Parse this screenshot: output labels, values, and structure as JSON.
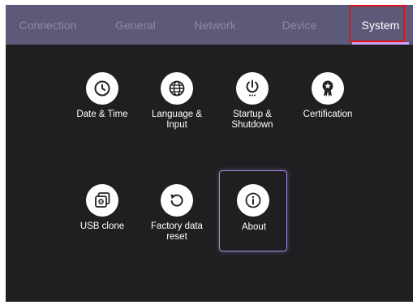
{
  "tabs": [
    {
      "label": "Connection"
    },
    {
      "label": "General"
    },
    {
      "label": "Network"
    },
    {
      "label": "Device"
    },
    {
      "label": "System"
    }
  ],
  "active_tab": "System",
  "colors": {
    "tab_bar": "#5c5a78",
    "tab_inactive_text": "#8b89a4",
    "tab_active_underline": "#c8a4ff",
    "screen_background": "#1f1f21",
    "highlight_box": "#e0141e",
    "selected_tile_border": "#a98be0"
  },
  "tiles": [
    {
      "label": "Date & Time",
      "icon": "clock-icon"
    },
    {
      "label": "Language &\nInput",
      "icon": "globe-icon"
    },
    {
      "label": "Startup &\nShutdown",
      "icon": "power-icon"
    },
    {
      "label": "Certification",
      "icon": "award-ribbon-icon"
    },
    {
      "label": "USB clone",
      "icon": "usb-clone-icon"
    },
    {
      "label": "Factory data\nreset",
      "icon": "reset-arrow-icon"
    },
    {
      "label": "About",
      "icon": "info-icon"
    }
  ],
  "selected_tile": "About"
}
